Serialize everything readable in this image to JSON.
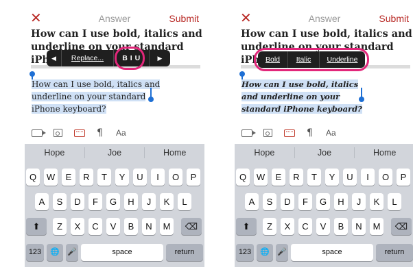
{
  "nav": {
    "close": "✕",
    "title": "Answer",
    "submit": "Submit"
  },
  "question": "How can I use bold, italics and underline on your standard iPhone keyboard?",
  "left_panel": {
    "popup": {
      "prev_arrow": "◀",
      "replace": "Replace...",
      "biu": "B I U",
      "next_arrow": "▶"
    },
    "answer_text": "How can I use bold, italics and underline on your standard iPhone keyboard?"
  },
  "right_panel": {
    "popup": {
      "bold": "Bold",
      "italic": "Italic",
      "underline": "Underline"
    },
    "answer_text": "How can I use bold, italics and underline on your standard iPhone keyboard?"
  },
  "toolbar": {
    "icons": [
      "video-icon",
      "photo-icon",
      "keyboard-icon",
      "paragraph-icon",
      "text-format-icon"
    ],
    "paragraph": "¶",
    "text_format": "Aa"
  },
  "keyboard": {
    "suggestions": [
      "Hope",
      "Joe",
      "Home"
    ],
    "row1": [
      "Q",
      "W",
      "E",
      "R",
      "T",
      "Y",
      "U",
      "I",
      "O",
      "P"
    ],
    "row2": [
      "A",
      "S",
      "D",
      "F",
      "G",
      "H",
      "J",
      "K",
      "L"
    ],
    "row3": [
      "Z",
      "X",
      "C",
      "V",
      "B",
      "N",
      "M"
    ],
    "shift": "⬆",
    "delete": "⌫",
    "numbers": "123",
    "globe": "🌐",
    "mic": "🎤",
    "space": "space",
    "return": "return"
  },
  "colors": {
    "accent": "#b92b27",
    "highlight_ring": "#e2267a",
    "selection": "#cfe0f5",
    "handle": "#1e6fd4"
  }
}
